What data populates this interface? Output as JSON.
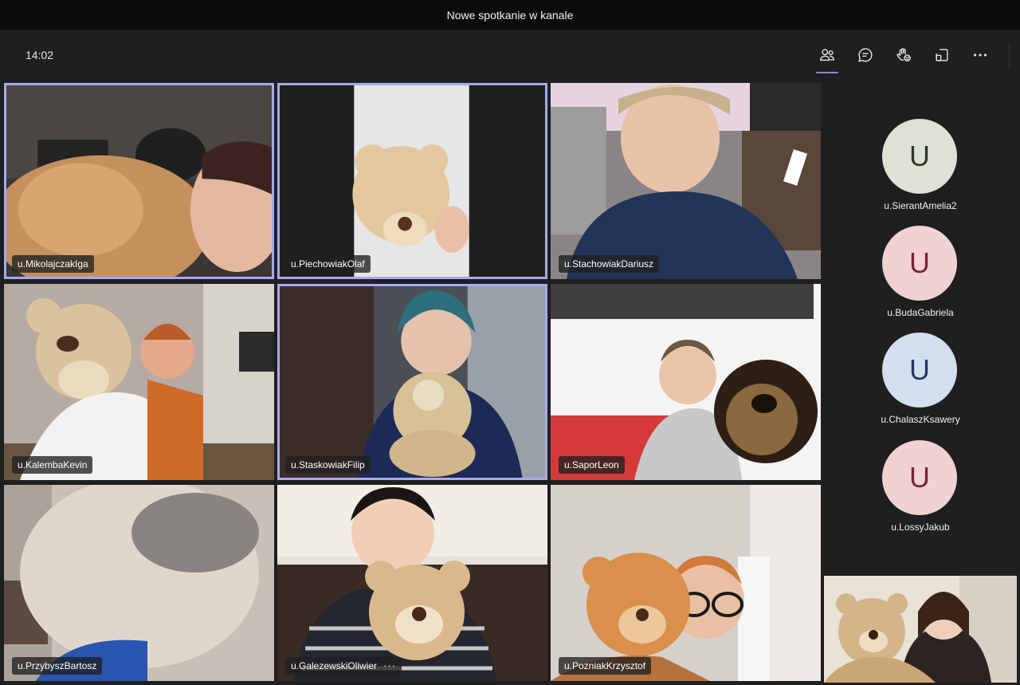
{
  "window": {
    "title": "Nowe spotkanie w kanale"
  },
  "toolbar": {
    "time": "14:02",
    "items": [
      {
        "icon": "people-icon",
        "active": true
      },
      {
        "icon": "chat-icon",
        "active": false
      },
      {
        "icon": "raise-hand-icon",
        "active": false
      },
      {
        "icon": "breakout-rooms-icon",
        "active": false
      },
      {
        "icon": "more-actions-icon",
        "active": false
      }
    ]
  },
  "tiles": [
    {
      "name": "u.MikolajczakIga",
      "speaking": true
    },
    {
      "name": "u.PiechowiakOlaf",
      "speaking": true
    },
    {
      "name": "u.StachowiakDariusz",
      "speaking": false
    },
    {
      "name": "u.KalembaKevin",
      "speaking": false
    },
    {
      "name": "u.StaskowiakFilip",
      "speaking": true
    },
    {
      "name": "u.SaporLeon",
      "speaking": false
    },
    {
      "name": "u.PrzybyszBartosz",
      "speaking": false
    },
    {
      "name": "u.GalezewskiOliwier",
      "speaking": false,
      "more": "···"
    },
    {
      "name": "u.PozniakKrzysztof",
      "speaking": false
    }
  ],
  "roster": [
    {
      "initial": "U",
      "name": "u.SierantAmelia2",
      "bg": "#dde1d6",
      "fg": "#2b3a22"
    },
    {
      "initial": "U",
      "name": "u.BudaGabriela",
      "bg": "#f1d1d4",
      "fg": "#7a2434"
    },
    {
      "initial": "U",
      "name": "u.ChalaszKsawery",
      "bg": "#d3dff0",
      "fg": "#1f3a63"
    },
    {
      "initial": "U",
      "name": "u.LossyJakub",
      "bg": "#f1d1d4",
      "fg": "#7a2434"
    }
  ],
  "colors": {
    "speaking_border": "#a7a8f2",
    "active_tab": "#8b8cc7",
    "background": "#1f1f1f"
  }
}
